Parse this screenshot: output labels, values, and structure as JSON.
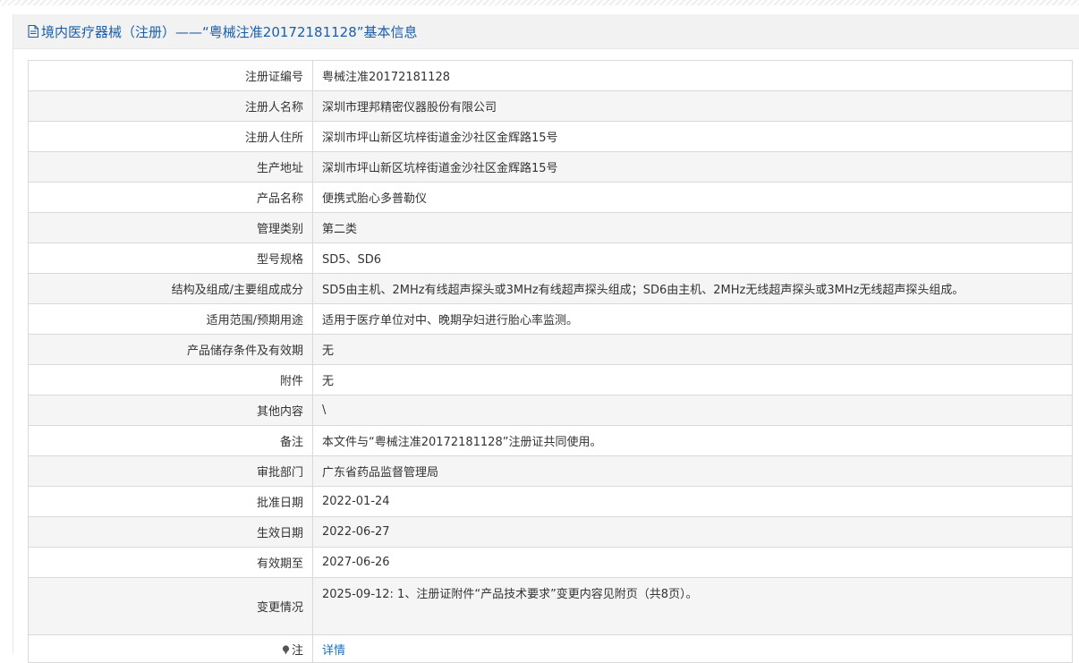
{
  "header": {
    "title": "境内医疗器械（注册）——“粤械注准20172181128”基本信息",
    "icon": "document-icon"
  },
  "rows": [
    {
      "label": "注册证编号",
      "value": "粤械注准20172181128"
    },
    {
      "label": "注册人名称",
      "value": "深圳市理邦精密仪器股份有限公司"
    },
    {
      "label": "注册人住所",
      "value": "深圳市坪山新区坑梓街道金沙社区金辉路15号"
    },
    {
      "label": "生产地址",
      "value": "深圳市坪山新区坑梓街道金沙社区金辉路15号"
    },
    {
      "label": "产品名称",
      "value": "便携式胎心多普勒仪"
    },
    {
      "label": "管理类别",
      "value": "第二类"
    },
    {
      "label": "型号规格",
      "value": "SD5、SD6"
    },
    {
      "label": "结构及组成/主要组成成分",
      "value": "SD5由主机、2MHz有线超声探头或3MHz有线超声探头组成；SD6由主机、2MHz无线超声探头或3MHz无线超声探头组成。"
    },
    {
      "label": "适用范围/预期用途",
      "value": "适用于医疗单位对中、晚期孕妇进行胎心率监测。"
    },
    {
      "label": "产品储存条件及有效期",
      "value": "无"
    },
    {
      "label": "附件",
      "value": "无"
    },
    {
      "label": "其他内容",
      "value": "\\"
    },
    {
      "label": "备注",
      "value": "本文件与“粤械注准20172181128”注册证共同使用。"
    },
    {
      "label": "审批部门",
      "value": "广东省药品监督管理局"
    },
    {
      "label": "批准日期",
      "value": "2022-01-24"
    },
    {
      "label": "生效日期",
      "value": "2022-06-27"
    },
    {
      "label": "有效期至",
      "value": "2027-06-26"
    }
  ],
  "change": {
    "label": "变更情况",
    "value": "2025-09-12: 1、注册证附件“产品技术要求”变更内容见附页（共8页）。"
  },
  "note": {
    "label": "注",
    "link_text": "详情",
    "icon": "pin-icon"
  },
  "colors": {
    "title": "#1a5ea8",
    "link": "#1a6fc4",
    "header_bg": "#f2f2f2",
    "row_alt": "#f5f5f5",
    "border": "#d9d9d9"
  }
}
